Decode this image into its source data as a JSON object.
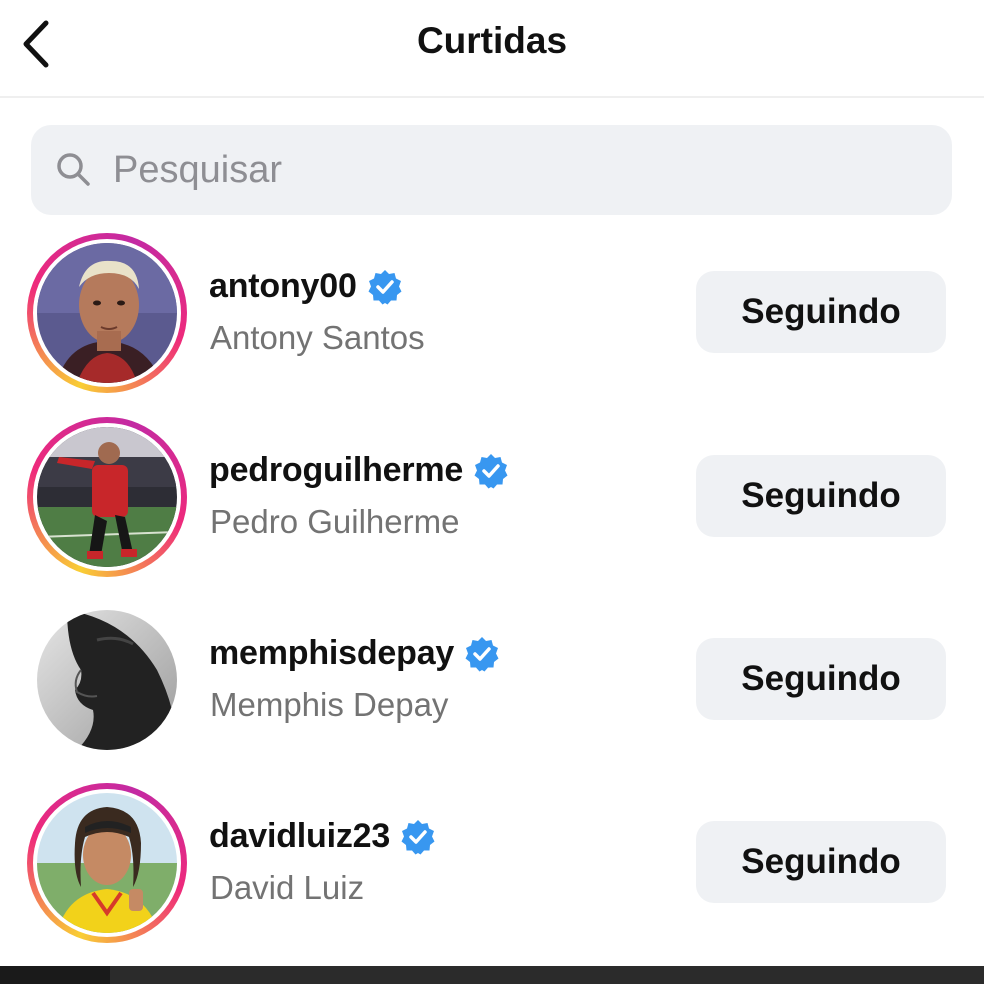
{
  "header": {
    "title": "Curtidas",
    "back_icon": "chevron-left-icon"
  },
  "search": {
    "placeholder": "Pesquisar",
    "icon": "search-icon"
  },
  "colors": {
    "verified_blue": "#3897f0",
    "button_bg": "#eff1f4",
    "secondary_text": "#737373"
  },
  "users": [
    {
      "username": "antony00",
      "full_name": "Antony Santos",
      "verified": true,
      "story_ring": true,
      "button_label": "Seguindo"
    },
    {
      "username": "pedroguilherme",
      "full_name": "Pedro Guilherme",
      "verified": true,
      "story_ring": true,
      "button_label": "Seguindo"
    },
    {
      "username": "memphisdepay",
      "full_name": "Memphis Depay",
      "verified": true,
      "story_ring": false,
      "button_label": "Seguindo"
    },
    {
      "username": "davidluiz23",
      "full_name": "David Luiz",
      "verified": true,
      "story_ring": true,
      "button_label": "Seguindo"
    }
  ]
}
